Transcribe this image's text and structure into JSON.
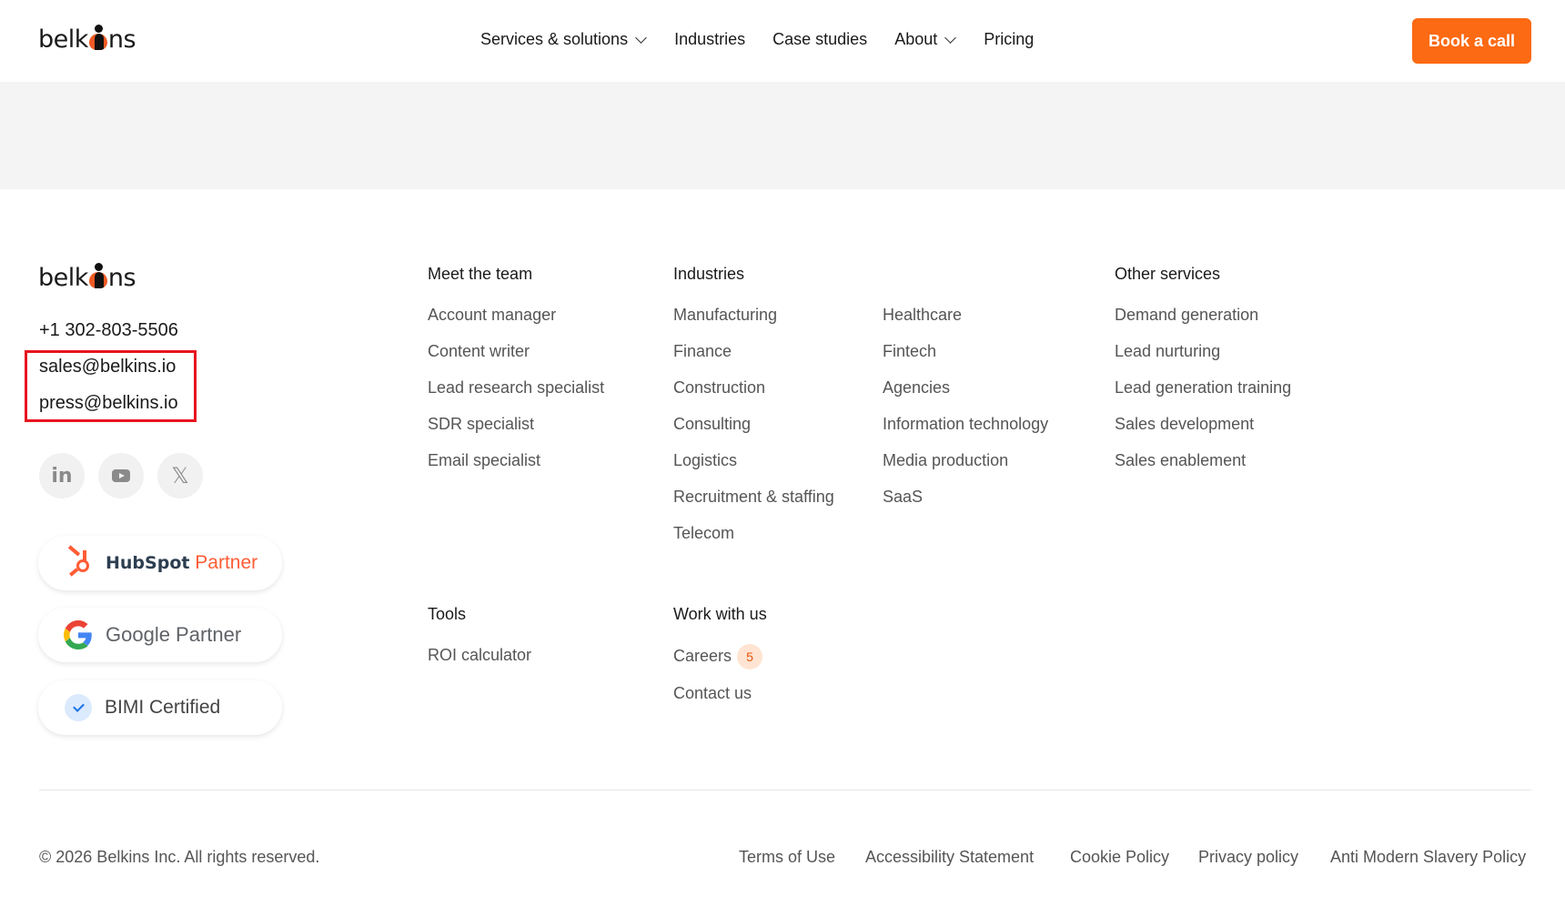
{
  "header": {
    "logo_prefix": "belk",
    "logo_suffix": "ns",
    "nav": [
      {
        "label": "Services & solutions",
        "has_dropdown": true
      },
      {
        "label": "Industries",
        "has_dropdown": false
      },
      {
        "label": "Case studies",
        "has_dropdown": false
      },
      {
        "label": "About",
        "has_dropdown": true
      },
      {
        "label": "Pricing",
        "has_dropdown": false
      }
    ],
    "cta_label": "Book a call"
  },
  "footer": {
    "logo_prefix": "belk",
    "logo_suffix": "ns",
    "phone": "+1 302-803-5506",
    "emails": [
      "sales@belkins.io",
      "press@belkins.io"
    ],
    "social": [
      {
        "icon": "linkedin-icon",
        "glyph": "in"
      },
      {
        "icon": "youtube-icon"
      },
      {
        "icon": "x-twitter-icon",
        "glyph": "𝕏"
      }
    ],
    "badges": {
      "hubspot": {
        "brand": "HubSpot",
        "suffix": "Partner"
      },
      "google": {
        "label": "Google Partner"
      },
      "bimi": {
        "label": "BIMI Certified"
      }
    },
    "columns": {
      "meet_team": {
        "title": "Meet the team",
        "links": [
          "Account manager",
          "Content writer",
          "Lead research specialist",
          "SDR specialist",
          "Email specialist"
        ]
      },
      "industries": {
        "title": "Industries",
        "links_a": [
          "Manufacturing",
          "Finance",
          "Construction",
          "Consulting",
          "Logistics",
          "Recruitment & staffing",
          "Telecom"
        ],
        "links_b": [
          "Healthcare",
          "Fintech",
          "Agencies",
          "Information technology",
          "Media production",
          "SaaS"
        ]
      },
      "other_services": {
        "title": "Other services",
        "links": [
          "Demand generation",
          "Lead nurturing",
          "Lead generation training",
          "Sales development",
          "Sales enablement"
        ]
      },
      "tools": {
        "title": "Tools",
        "links": [
          "ROI calculator"
        ]
      },
      "work_with_us": {
        "title": "Work with us",
        "careers_label": "Careers",
        "careers_count": "5",
        "contact_label": "Contact us"
      }
    },
    "copyright": "© 2026 Belkins Inc. All rights reserved.",
    "legal": [
      "Terms of Use",
      "Accessibility Statement",
      "Cookie Policy",
      "Privacy policy",
      "Anti Modern Slavery Policy"
    ]
  },
  "colors": {
    "accent": "#fc6a13",
    "highlight_box": "#e8141f",
    "hubspot_orange": "#ff5c35",
    "band_gray": "#f4f4f4"
  }
}
